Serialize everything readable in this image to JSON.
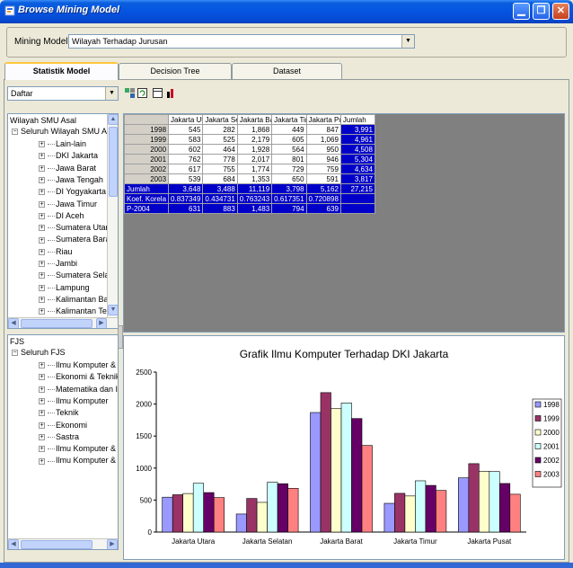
{
  "window": {
    "title": "Browse Mining Model"
  },
  "mining_model": {
    "label": "Mining Model :",
    "value": "Wilayah Terhadap Jurusan"
  },
  "tabs": [
    {
      "label": "Statistik Model",
      "active": true
    },
    {
      "label": "Decision Tree",
      "active": false
    },
    {
      "label": "Dataset",
      "active": false
    }
  ],
  "view_select": {
    "value": "Daftar"
  },
  "tree_top": {
    "root": "Wilayah SMU Asal",
    "child": "Seluruh Wilayah SMU Asal",
    "items": [
      "Lain-lain",
      "DKI Jakarta",
      "Jawa Barat",
      "Jawa Tengah",
      "DI Yogyakarta",
      "Jawa Timur",
      "DI Aceh",
      "Sumatera Utara",
      "Sumatera Barat",
      "Riau",
      "Jambi",
      "Sumatera Selatan",
      "Lampung",
      "Kalimantan Barat",
      "Kalimantan Tengah"
    ]
  },
  "tree_bottom": {
    "root": "FJS",
    "child": "Seluruh FJS",
    "items": [
      "Ilmu Komputer & Teknik",
      "Ekonomi & Teknik",
      "Matematika dan Ilmu Pe",
      "Ilmu Komputer",
      "Teknik",
      "Ekonomi",
      "Sastra",
      "Ilmu Komputer & Ekono",
      "Ilmu Komputer & Matem"
    ]
  },
  "grid": {
    "columns": [
      "Jakarta Utar",
      "Jakarta Sela",
      "Jakarta Bara",
      "Jakarta Tim",
      "Jakarta Pus",
      "Jumlah"
    ],
    "rows": [
      {
        "label": "1998",
        "cells": [
          "545",
          "282",
          "1,868",
          "449",
          "847",
          "3,991"
        ]
      },
      {
        "label": "1999",
        "cells": [
          "583",
          "525",
          "2,179",
          "605",
          "1,069",
          "4,961"
        ]
      },
      {
        "label": "2000",
        "cells": [
          "602",
          "464",
          "1,928",
          "564",
          "950",
          "4,508"
        ]
      },
      {
        "label": "2001",
        "cells": [
          "762",
          "778",
          "2,017",
          "801",
          "946",
          "5,304"
        ]
      },
      {
        "label": "2002",
        "cells": [
          "617",
          "755",
          "1,774",
          "729",
          "759",
          "4,634"
        ]
      },
      {
        "label": "2003",
        "cells": [
          "539",
          "684",
          "1,353",
          "650",
          "591",
          "3,817"
        ]
      }
    ],
    "summary_rows": [
      {
        "label": "Jumlah",
        "cells": [
          "3,648",
          "3,488",
          "11,119",
          "3,798",
          "5,162",
          "27,215"
        ]
      },
      {
        "label": "Koef. Korela",
        "cells": [
          "0.837349",
          "0.434731",
          "0.763243",
          "0.617351",
          "0.720898",
          ""
        ]
      },
      {
        "label": "P-2004",
        "cells": [
          "631",
          "883",
          "1,483",
          "794",
          "639",
          ""
        ]
      }
    ]
  },
  "colors": {
    "titlebar": "#0554E0",
    "selected": "#0000C8"
  },
  "chart_data": {
    "type": "bar",
    "title": "Grafik Ilmu Komputer Terhadap DKI Jakarta",
    "categories": [
      "Jakarta Utara",
      "Jakarta Selatan",
      "Jakarta Barat",
      "Jakarta Timur",
      "Jakarta Pusat"
    ],
    "series": [
      {
        "name": "1998",
        "color": "#9999FF",
        "values": [
          545,
          282,
          1868,
          449,
          847
        ]
      },
      {
        "name": "1999",
        "color": "#993366",
        "values": [
          583,
          525,
          2179,
          605,
          1069
        ]
      },
      {
        "name": "2000",
        "color": "#FFFFCC",
        "values": [
          602,
          464,
          1928,
          564,
          950
        ]
      },
      {
        "name": "2001",
        "color": "#CCFFFF",
        "values": [
          762,
          778,
          2017,
          801,
          946
        ]
      },
      {
        "name": "2002",
        "color": "#660066",
        "values": [
          617,
          755,
          1774,
          729,
          759
        ]
      },
      {
        "name": "2003",
        "color": "#FF8080",
        "values": [
          539,
          684,
          1353,
          650,
          591
        ]
      }
    ],
    "ylim": [
      0,
      2500
    ],
    "yticks": [
      "0",
      "500",
      "1000",
      "1500",
      "2000",
      "2500"
    ],
    "ytick_values": [
      0,
      500,
      1000,
      1500,
      2000,
      2500
    ],
    "legend": "right",
    "grid": false
  }
}
